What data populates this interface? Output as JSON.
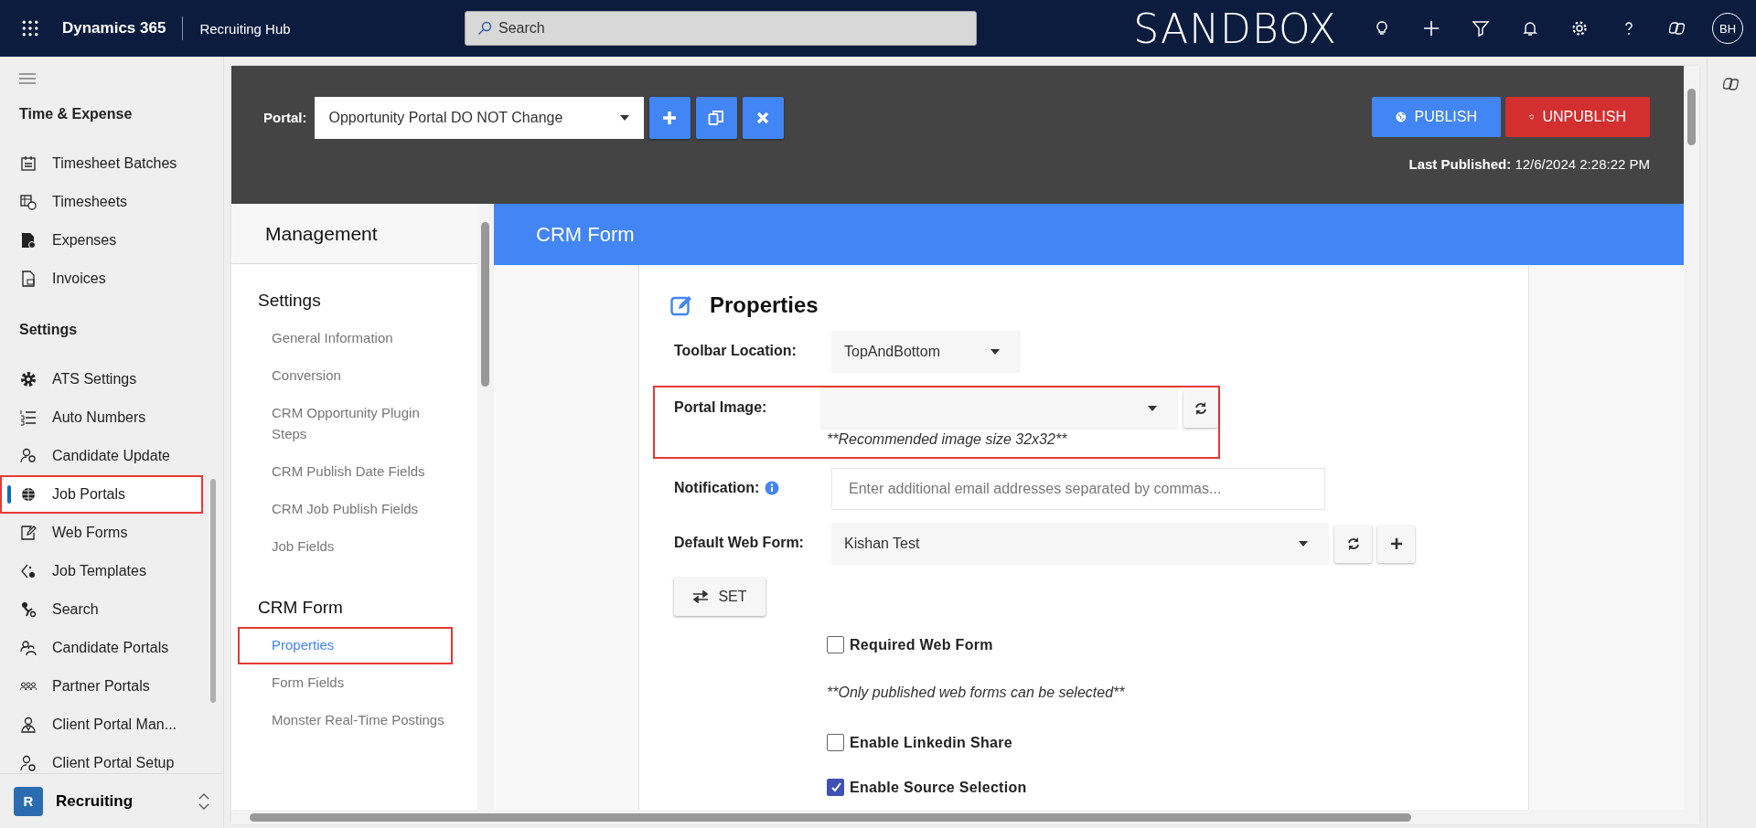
{
  "app": {
    "name": "Dynamics 365",
    "area": "Recruiting Hub",
    "search_placeholder": "Search",
    "environment": "SANDBOX",
    "user_initials": "BH"
  },
  "sidebar": {
    "groups": [
      {
        "title": "Time & Expense",
        "items": [
          {
            "label": "Timesheet Batches",
            "selected": false,
            "annotated": false
          },
          {
            "label": "Timesheets",
            "selected": false,
            "annotated": false
          },
          {
            "label": "Expenses",
            "selected": false,
            "annotated": false
          },
          {
            "label": "Invoices",
            "selected": false,
            "annotated": false
          }
        ]
      },
      {
        "title": "Settings",
        "items": [
          {
            "label": "ATS Settings",
            "selected": false,
            "annotated": false
          },
          {
            "label": "Auto Numbers",
            "selected": false,
            "annotated": false
          },
          {
            "label": "Candidate Update",
            "selected": false,
            "annotated": false
          },
          {
            "label": "Job Portals",
            "selected": true,
            "annotated": true
          },
          {
            "label": "Web Forms",
            "selected": false,
            "annotated": false
          },
          {
            "label": "Job Templates",
            "selected": false,
            "annotated": false
          },
          {
            "label": "Search",
            "selected": false,
            "annotated": false
          },
          {
            "label": "Candidate Portals",
            "selected": false,
            "annotated": false
          },
          {
            "label": "Partner Portals",
            "selected": false,
            "annotated": false
          },
          {
            "label": "Client Portal Man...",
            "selected": false,
            "annotated": false
          },
          {
            "label": "Client Portal Setup",
            "selected": false,
            "annotated": false
          }
        ]
      }
    ],
    "area_switcher": {
      "badge": "R",
      "label": "Recruiting"
    }
  },
  "portal_bar": {
    "label": "Portal:",
    "value": "Opportunity Portal DO NOT Change",
    "publish": "PUBLISH",
    "unpublish": "UNPUBLISH",
    "last_published_label": "Last Published:",
    "last_published": "12/6/2024 2:28:22 PM"
  },
  "management": {
    "title": "Management",
    "sections": [
      {
        "title": "Settings",
        "items": [
          {
            "label": "General Information",
            "selected": false,
            "annotated": false
          },
          {
            "label": "Conversion",
            "selected": false,
            "annotated": false
          },
          {
            "label": "CRM Opportunity Plugin Steps",
            "selected": false,
            "annotated": false
          },
          {
            "label": "CRM Publish Date Fields",
            "selected": false,
            "annotated": false
          },
          {
            "label": "CRM Job Publish Fields",
            "selected": false,
            "annotated": false
          },
          {
            "label": "Job Fields",
            "selected": false,
            "annotated": false
          }
        ]
      },
      {
        "title": "CRM Form",
        "items": [
          {
            "label": "Properties",
            "selected": true,
            "annotated": true
          },
          {
            "label": "Form Fields",
            "selected": false,
            "annotated": false
          },
          {
            "label": "Monster Real-Time Postings",
            "selected": false,
            "annotated": false
          }
        ]
      }
    ]
  },
  "page": {
    "header": "CRM Form",
    "title": "Properties",
    "rows": [
      {
        "kind": "select",
        "label": "Toolbar Location:",
        "value": "TopAndBottom",
        "actions": []
      },
      {
        "kind": "select",
        "label": "Portal Image:",
        "actions": [
          {
            "kind": "refresh"
          }
        ],
        "hint": "**Recommended image size 32x32**",
        "annotated": true
      },
      {
        "kind": "input",
        "label": "Notification:",
        "placeholder": "Enter additional email addresses separated by commas...",
        "info": true
      },
      {
        "kind": "select",
        "label": "Default Web Form:",
        "value": "Kishan Test",
        "actions": [
          {
            "kind": "refresh"
          },
          {
            "kind": "add"
          }
        ]
      },
      {
        "kind": "button",
        "label": "SET"
      },
      {
        "kind": "checkbox",
        "label": "Required Web Form",
        "checked": false
      },
      {
        "kind": "note",
        "label": "**Only published web forms can be selected**"
      },
      {
        "kind": "checkbox",
        "label": "Enable Linkedin Share",
        "checked": false
      },
      {
        "kind": "checkbox",
        "label": "Enable Source Selection",
        "checked": true
      }
    ]
  }
}
